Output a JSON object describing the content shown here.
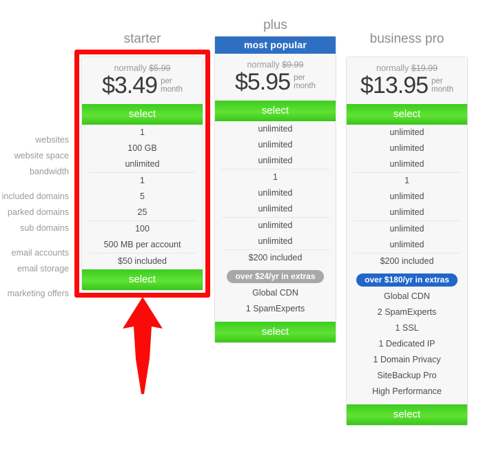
{
  "feature_labels": [
    [
      "websites",
      "website space",
      "bandwidth"
    ],
    [
      "included domains",
      "parked domains",
      "sub domains"
    ],
    [
      "email accounts",
      "email storage"
    ],
    [
      "marketing offers"
    ]
  ],
  "plans": [
    {
      "name": "starter",
      "banner": null,
      "normally_prefix": "normally",
      "normally_price": "$5.99",
      "price": "$3.49",
      "per": "per",
      "month": "month",
      "select_label": "select",
      "features": [
        [
          "1",
          "100 GB",
          "unlimited"
        ],
        [
          "1",
          "5",
          "25"
        ],
        [
          "100",
          "500 MB per account"
        ],
        [
          "$50 included"
        ]
      ],
      "extras_pill": null,
      "extras": [],
      "bottom_select_label": "select"
    },
    {
      "name": "plus",
      "banner": "most popular",
      "normally_prefix": "normally",
      "normally_price": "$9.99",
      "price": "$5.95",
      "per": "per",
      "month": "month",
      "select_label": "select",
      "features": [
        [
          "unlimited",
          "unlimited",
          "unlimited"
        ],
        [
          "1",
          "unlimited",
          "unlimited"
        ],
        [
          "unlimited",
          "unlimited"
        ],
        [
          "$200 included"
        ]
      ],
      "extras_pill": "over $24/yr in extras",
      "extras": [
        "Global CDN",
        "1 SpamExperts"
      ],
      "bottom_select_label": "select"
    },
    {
      "name": "business pro",
      "banner": null,
      "normally_prefix": "normally",
      "normally_price": "$19.99",
      "price": "$13.95",
      "per": "per",
      "month": "month",
      "select_label": "select",
      "features": [
        [
          "unlimited",
          "unlimited",
          "unlimited"
        ],
        [
          "1",
          "unlimited",
          "unlimited"
        ],
        [
          "unlimited",
          "unlimited"
        ],
        [
          "$200 included"
        ]
      ],
      "extras_pill": "over $180/yr in extras",
      "extras": [
        "Global CDN",
        "2 SpamExperts",
        "1 SSL",
        "1 Dedicated IP",
        "1 Domain Privacy",
        "SiteBackup Pro",
        "High Performance"
      ],
      "bottom_select_label": "select"
    }
  ],
  "annotation": {
    "highlight_color": "#fb0a0a",
    "arrow_color": "#fb0a0a",
    "target_plan": "starter"
  },
  "colors": {
    "select_green": "#4ad626",
    "banner_blue": "#2e6fc4",
    "pill_gray": "#a8a8a8",
    "pill_blue": "#2166c9",
    "card_bg": "#f7f7f7"
  }
}
